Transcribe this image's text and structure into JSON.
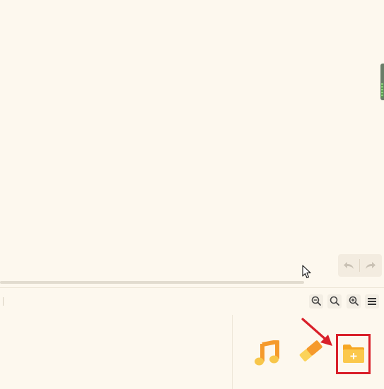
{
  "canvas": {
    "undo_icon": "undo-icon",
    "redo_icon": "redo-icon"
  },
  "toolbar": {
    "buttons": [
      {
        "name": "zoom-out-icon"
      },
      {
        "name": "zoom-reset-icon"
      },
      {
        "name": "zoom-in-icon"
      },
      {
        "name": "menu-icon"
      }
    ]
  },
  "assets": {
    "items": [
      {
        "name": "music-icon"
      },
      {
        "name": "eraser-icon"
      },
      {
        "name": "new-folder-icon"
      }
    ]
  },
  "colors": {
    "accent_orange": "#f6a623",
    "highlight_red": "#d9202a",
    "background": "#fdf8ee"
  }
}
